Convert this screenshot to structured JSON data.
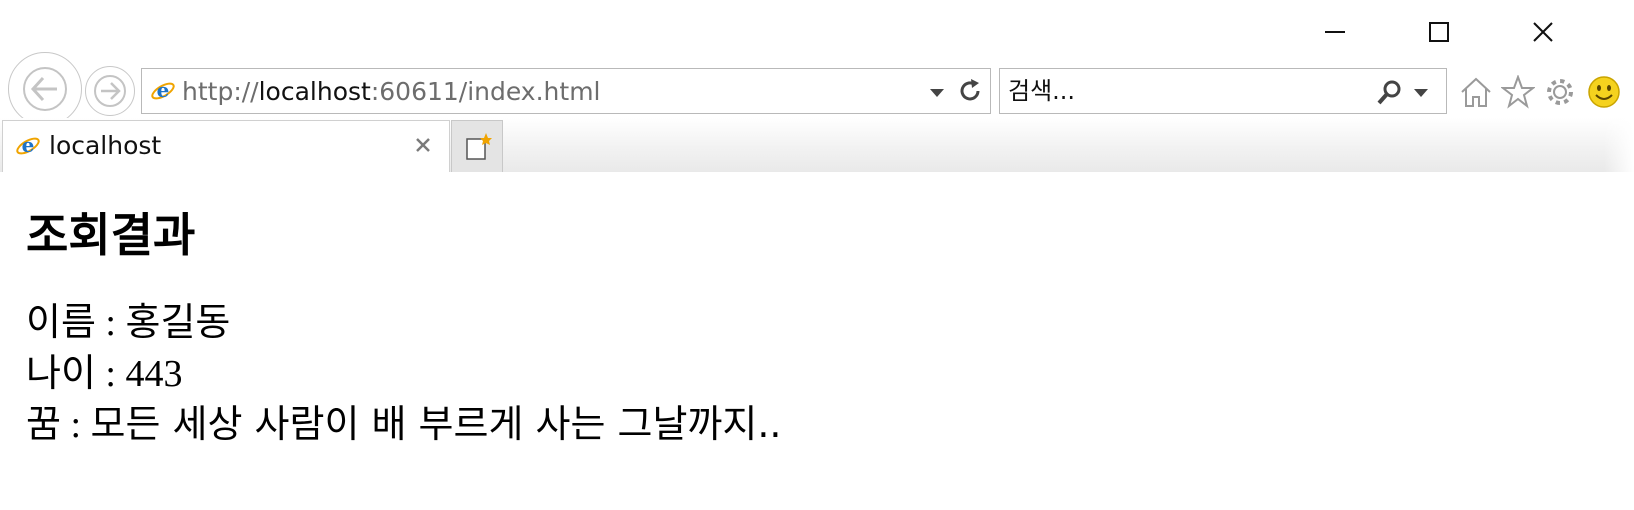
{
  "browser": {
    "address": {
      "scheme": "http://",
      "host": "localhost",
      "rest": ":60611/index.html"
    },
    "search": {
      "placeholder": "검색..."
    },
    "tab": {
      "title": "localhost",
      "close_glyph": "×"
    },
    "icons": {
      "back": "back-arrow-icon",
      "forward": "forward-arrow-icon",
      "site": "internet-explorer-icon",
      "dropdown": "chevron-down-icon",
      "refresh": "refresh-icon",
      "search": "search-icon",
      "home": "home-icon",
      "favorites": "star-icon",
      "tools": "gear-icon",
      "feedback": "smiley-icon",
      "new_tab": "new-tab-icon",
      "minimize": "minimize-icon",
      "maximize": "maximize-icon",
      "close": "close-icon"
    },
    "colors": {
      "ie_blue": "#1e73c8",
      "ie_orange": "#f0a400",
      "smiley_yellow": "#f5d21e"
    }
  },
  "page": {
    "title": "조회결과",
    "rows": [
      {
        "key": "이름",
        "sep": " : ",
        "value": "홍길동"
      },
      {
        "key": "나이",
        "sep": " : ",
        "value": "443"
      },
      {
        "key": "꿈",
        "sep": " : ",
        "value": "모든 세상 사람이 배 부르게 사는 그날까지.."
      }
    ]
  }
}
